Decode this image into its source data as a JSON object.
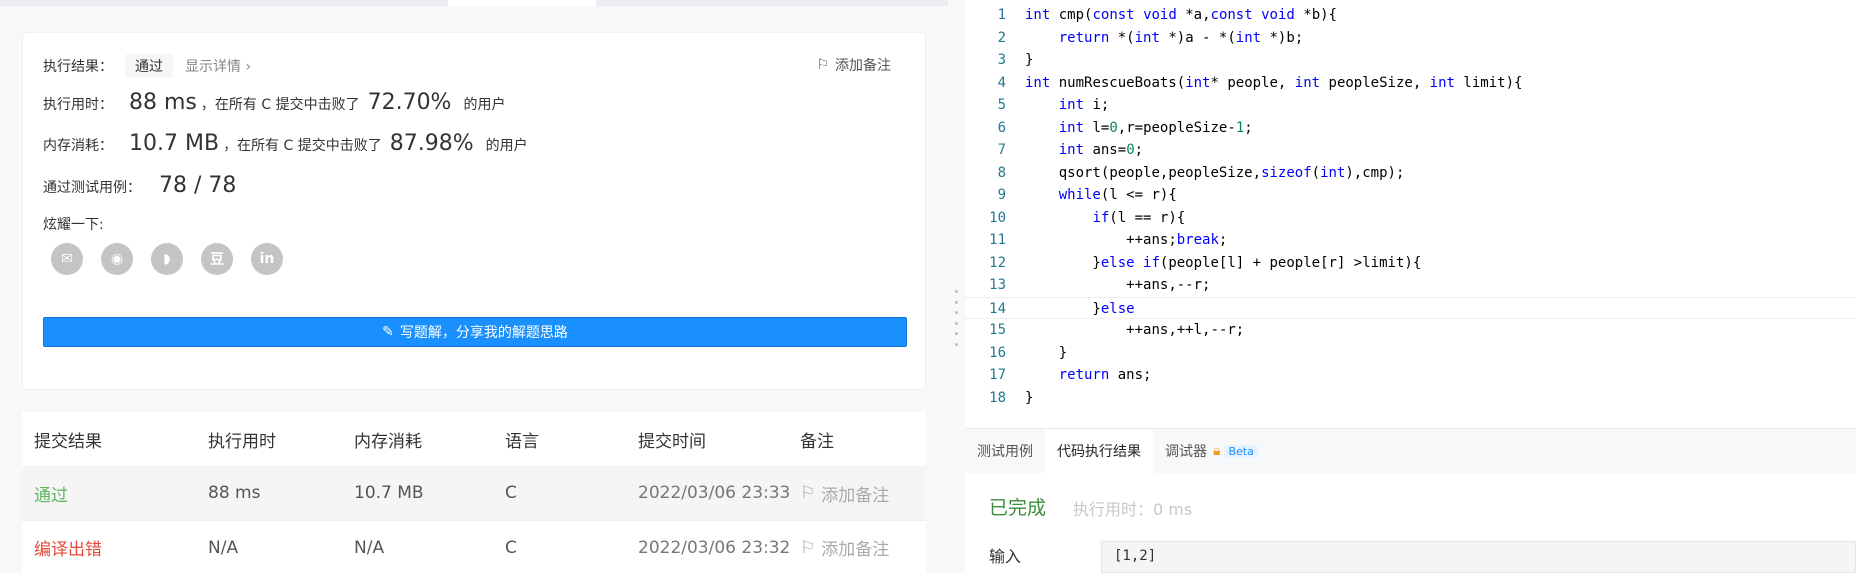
{
  "result_card": {
    "result_label": "执行结果：",
    "status_badge": "通过",
    "show_details": "显示详情 ›",
    "add_note": "添加备注",
    "runtime_label": "执行用时：",
    "runtime_value": "88 ms",
    "runtime_suffix": "，在所有 C 提交中击败了",
    "runtime_percent": "72.70%",
    "runtime_users": "的用户",
    "memory_label": "内存消耗：",
    "memory_value": "10.7 MB",
    "memory_suffix": "，在所有 C 提交中击败了",
    "memory_percent": "87.98%",
    "memory_users": "的用户",
    "tests_label": "通过测试用例：",
    "tests_value": "78 / 78",
    "share_label": "炫耀一下:",
    "share_icons": [
      "wechat-icon",
      "weibo-icon",
      "qq-icon",
      "douban-icon",
      "linkedin-icon"
    ],
    "share_glyphs": [
      "✉",
      "◉",
      "◗",
      "豆",
      "in"
    ],
    "write_solution": "写题解，分享我的解题思路"
  },
  "submissions": {
    "headers": [
      "提交结果",
      "执行用时",
      "内存消耗",
      "语言",
      "提交时间",
      "备注"
    ],
    "rows": [
      {
        "result": "通过",
        "runtime": "88 ms",
        "memory": "10.7 MB",
        "lang": "C",
        "time": "2022/03/06 23:33",
        "note": "添加备注"
      },
      {
        "result": "编译出错",
        "runtime": "N/A",
        "memory": "N/A",
        "lang": "C",
        "time": "2022/03/06 23:32",
        "note": "添加备注"
      }
    ]
  },
  "editor": {
    "active_line": 14,
    "lines": [
      "int cmp(const void *a,const void *b){",
      "    return *(int *)a - *(int *)b;",
      "}",
      "int numRescueBoats(int* people, int peopleSize, int limit){",
      "    int i;",
      "    int l=0,r=peopleSize-1;",
      "    int ans=0;",
      "    qsort(people,peopleSize,sizeof(int),cmp);",
      "    while(l <= r){",
      "        if(l == r){",
      "            ++ans;break;",
      "        }else if(people[l] + people[r] >limit){",
      "            ++ans,--r;",
      "        }else",
      "            ++ans,++l,--r;",
      "    }",
      "    return ans;",
      "}"
    ]
  },
  "bottom_panel": {
    "tabs": [
      "测试用例",
      "代码执行结果",
      "调试器"
    ],
    "active_tab": "代码执行结果",
    "beta": "Beta",
    "status": "已完成",
    "exec_time": "执行用时：0 ms",
    "input_label": "输入",
    "input_value": "[1,2]"
  },
  "colors": {
    "primary": "#1a90ff",
    "success": "#5cb85c",
    "error": "#e24a3b",
    "line_number": "#237893",
    "keyword": "#0000ff"
  }
}
